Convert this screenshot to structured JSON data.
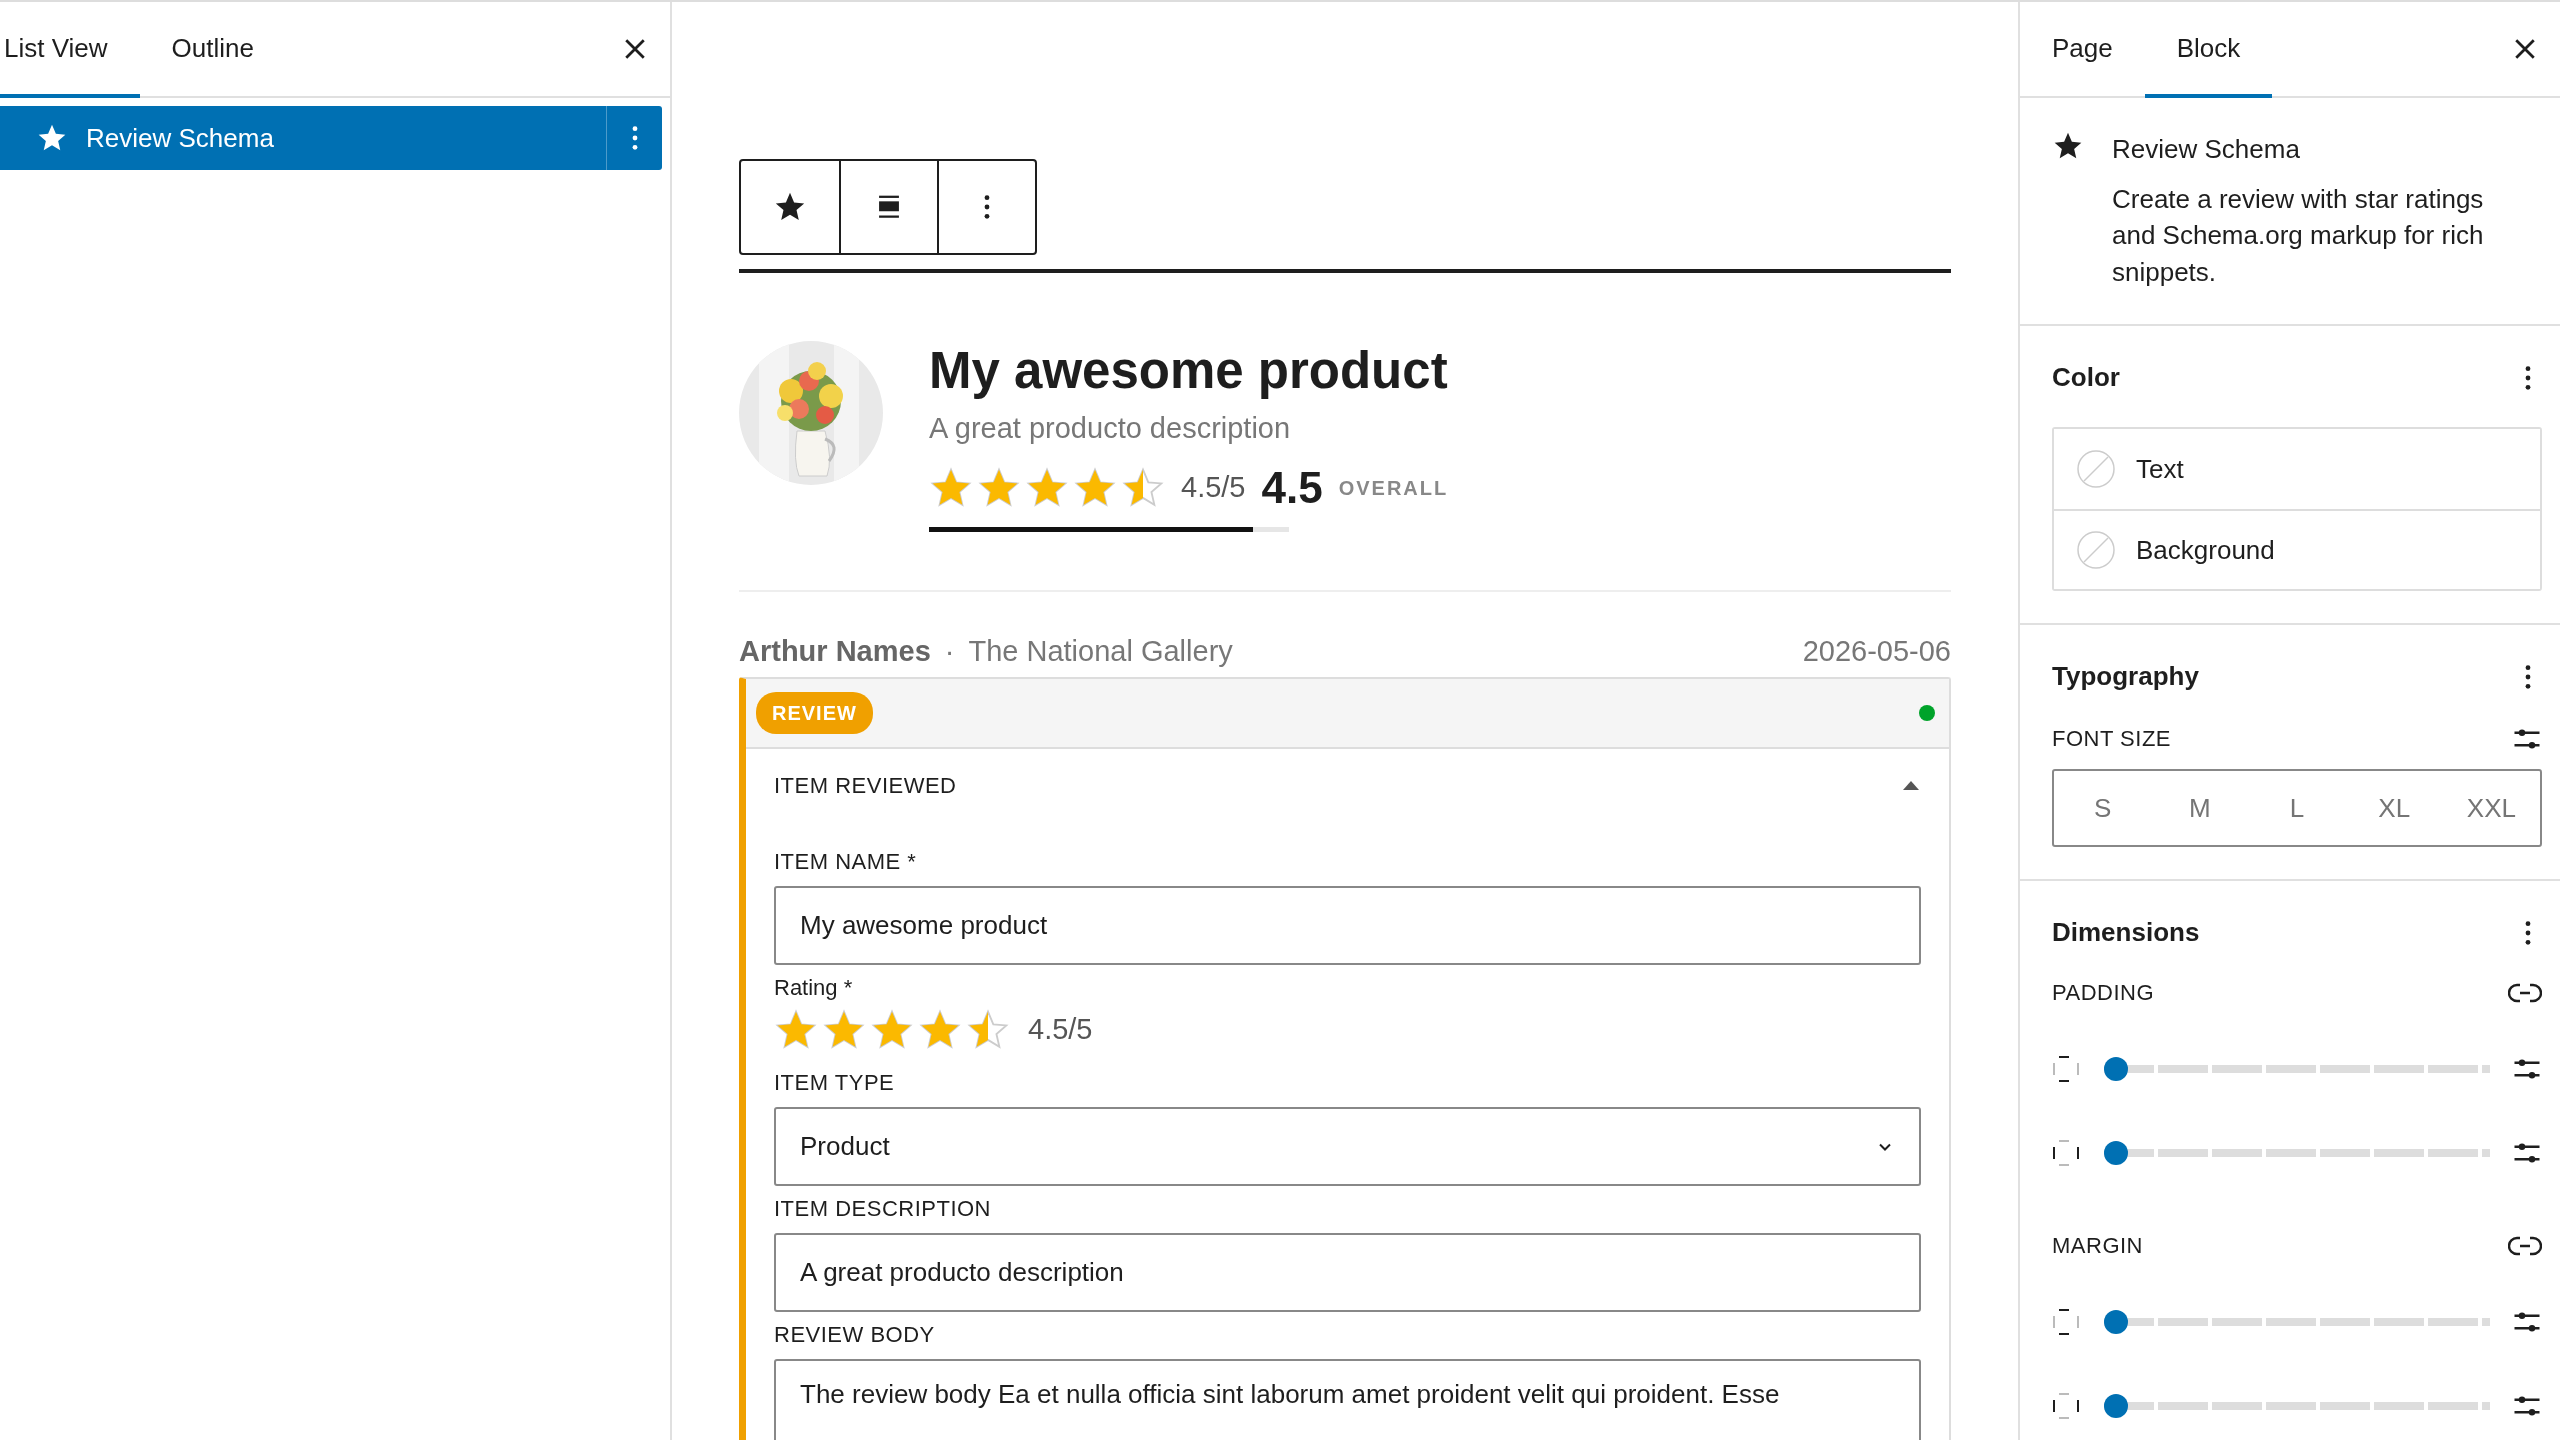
{
  "left_panel": {
    "tabs": [
      {
        "label": "List View",
        "selected": true
      },
      {
        "label": "Outline",
        "selected": false
      }
    ],
    "items": [
      {
        "label": "Review Schema",
        "selected": true
      }
    ]
  },
  "review": {
    "title": "My awesome product",
    "description": "A great producto description",
    "stars": 4.5,
    "score": "4.5/5",
    "overall_value": "4.5",
    "overall_label": "OVERALL",
    "level": 0.9,
    "author": "Arthur Names",
    "separator": "·",
    "publisher": "The National Gallery",
    "date": "2026-05-06"
  },
  "editor": {
    "badge": "REVIEW",
    "section": {
      "title": "ITEM REVIEWED",
      "expanded": true
    },
    "fields": [
      {
        "kind": "text",
        "label": "ITEM NAME *",
        "value": "My awesome product"
      },
      {
        "kind": "rating",
        "label": "Rating *",
        "stars": 4.5,
        "reading": "4.5/5"
      },
      {
        "kind": "select",
        "label": "ITEM TYPE",
        "value": "Product"
      },
      {
        "kind": "text",
        "label": "ITEM DESCRIPTION",
        "value": "A great producto description"
      },
      {
        "kind": "textarea",
        "label": "REVIEW BODY",
        "value": "The review body Ea et nulla officia sint laborum amet proident velit qui proident. Esse"
      }
    ]
  },
  "sidebar": {
    "tabs": [
      {
        "label": "Page",
        "selected": false
      },
      {
        "label": "Block",
        "selected": true
      }
    ],
    "block": {
      "title": "Review Schema",
      "description": "Create a review with star ratings and Schema.org markup for rich snippets."
    },
    "color": {
      "title": "Color",
      "options": [
        "Text",
        "Background"
      ]
    },
    "typography": {
      "title": "Typography",
      "font_size_label": "FONT SIZE",
      "sizes": [
        {
          "label": "S",
          "selected": false
        },
        {
          "label": "M",
          "selected": false
        },
        {
          "label": "L",
          "selected": false
        },
        {
          "label": "XL",
          "selected": false
        },
        {
          "label": "XXL",
          "selected": false
        }
      ]
    },
    "dimensions": {
      "title": "Dimensions",
      "groups": [
        {
          "label": "PADDING",
          "sliders": [
            {
              "kind": "vertical",
              "level": 0
            },
            {
              "kind": "horizontal",
              "level": 0
            }
          ]
        },
        {
          "label": "MARGIN",
          "sliders": [
            {
              "kind": "vertical",
              "level": 0
            },
            {
              "kind": "horizontal",
              "level": 0
            }
          ]
        }
      ]
    }
  }
}
